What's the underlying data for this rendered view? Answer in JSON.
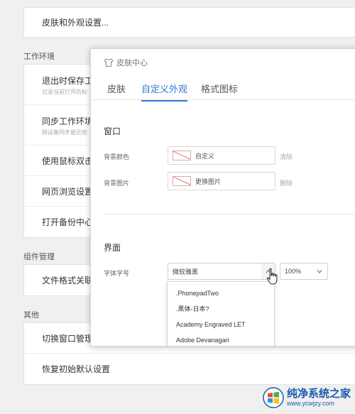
{
  "background": {
    "skin_item": "皮肤和外观设置...",
    "work_env_title": "工作环境",
    "work_env_items": [
      {
        "title": "退出时保存工",
        "sub": "记录当前打开的标"
      },
      {
        "title": "同步工作环境",
        "sub": "跨设备同步最近使"
      },
      {
        "title": "使用鼠标双击",
        "sub": ""
      },
      {
        "title": "网页浏览设置",
        "sub": ""
      },
      {
        "title": "打开备份中心",
        "sub": ""
      }
    ],
    "components_title": "组件管理",
    "components_items": [
      {
        "title": "文件格式关联"
      }
    ],
    "other_title": "其他",
    "other_items": [
      {
        "title": "切换窗口管理"
      },
      {
        "title": "恢复初始默认设置"
      }
    ]
  },
  "dialog": {
    "title": "皮肤中心",
    "tabs": [
      "皮肤",
      "自定义外观",
      "格式图标"
    ],
    "active_tab": 1,
    "window_section": "窗口",
    "bg_color_label": "背景颜色",
    "bg_color_value": "自定义",
    "bg_color_action": "清除",
    "bg_image_label": "背景图片",
    "bg_image_value": "更换图片",
    "bg_image_action": "删除",
    "interface_section": "界面",
    "font_label": "字体字号",
    "font_value": "微软雅黑",
    "font_size_value": "100%",
    "font_options": [
      ".PhonepadTwo",
      ".黑体-日本?",
      "Academy Engraved LET",
      "Adobe Devanagari"
    ]
  },
  "watermark": {
    "line1": "纯净系统之家",
    "line2": "www.ycwjzy.com"
  },
  "colors": {
    "accent": "#2b7bd3",
    "background": "#f0f0f0",
    "watermark": "#1a5bb0"
  }
}
